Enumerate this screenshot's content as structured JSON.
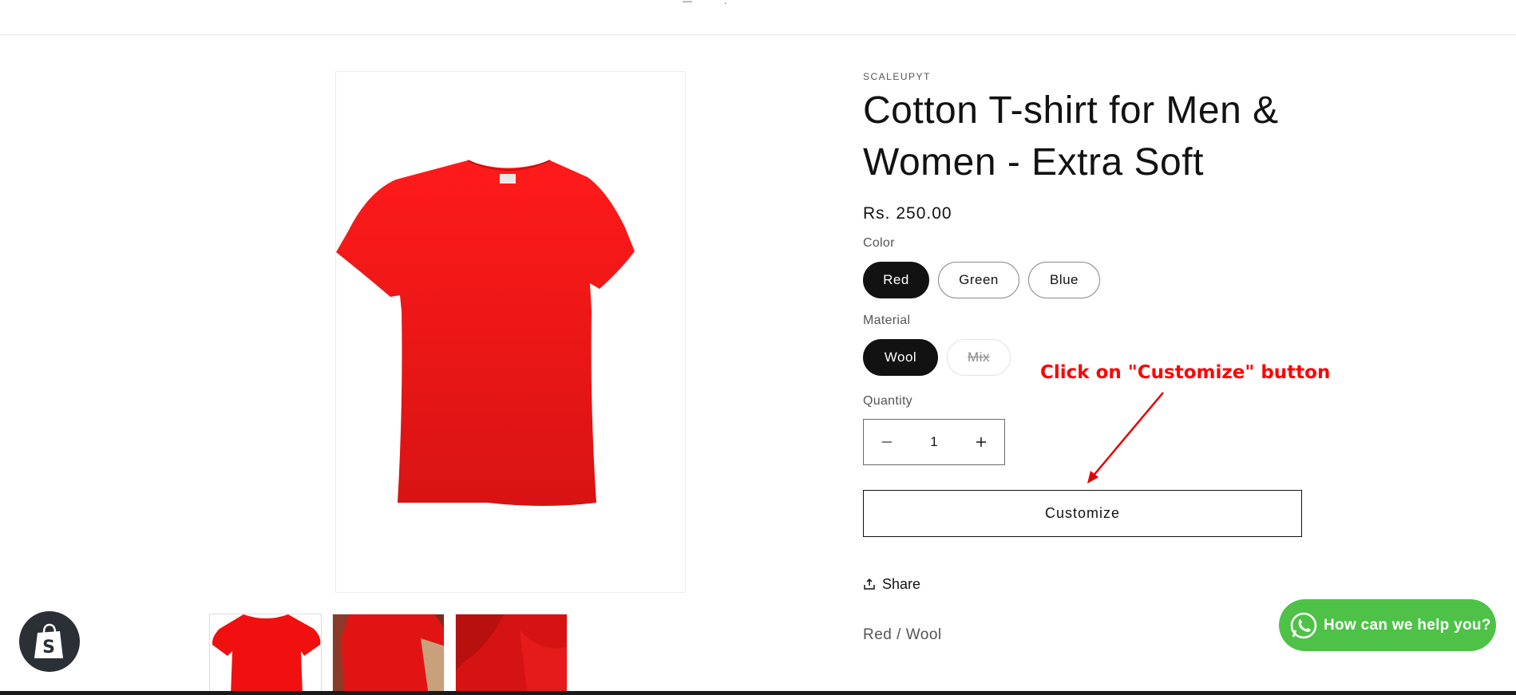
{
  "product": {
    "vendor": "SCALEUPYT",
    "title_line1": "Cotton T-shirt for Men &",
    "title_line2": "Women - Extra Soft",
    "price": "Rs. 250.00",
    "image_color": "#ee1111"
  },
  "options": {
    "color": {
      "label": "Color",
      "values": [
        {
          "label": "Red",
          "selected": true
        },
        {
          "label": "Green",
          "selected": false
        },
        {
          "label": "Blue",
          "selected": false
        }
      ]
    },
    "material": {
      "label": "Material",
      "values": [
        {
          "label": "Wool",
          "selected": true
        },
        {
          "label": "Mix",
          "selected": false,
          "disabled": true
        }
      ]
    }
  },
  "quantity": {
    "label": "Quantity",
    "value": "1",
    "decrease_icon": "minus-icon",
    "increase_icon": "plus-icon"
  },
  "actions": {
    "customize_label": "Customize",
    "share_label": "Share"
  },
  "variant_summary": "Red / Wool",
  "annotation": {
    "text": "Click on \"Customize\" button",
    "color": "#ff0000"
  },
  "whatsapp": {
    "label": "How can we help you?",
    "color": "#4dc247"
  },
  "thumbnails": [
    {
      "name": "front",
      "active": true
    },
    {
      "name": "model-brick-wall",
      "active": false
    },
    {
      "name": "closeup-fabric",
      "active": false
    }
  ]
}
